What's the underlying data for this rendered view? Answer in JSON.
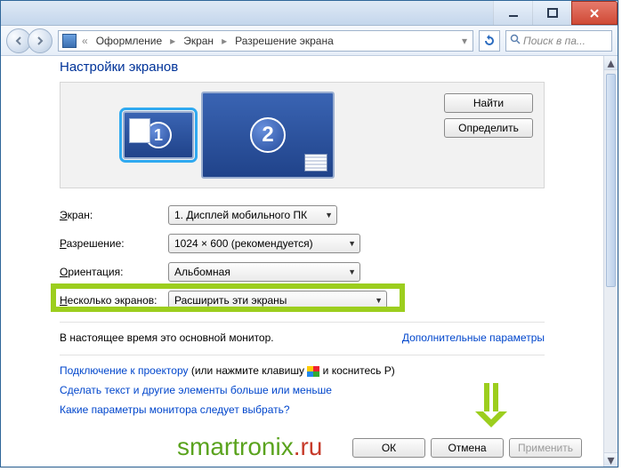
{
  "breadcrumb": {
    "item1": "Оформление",
    "item2": "Экран",
    "item3": "Разрешение экрана"
  },
  "search": {
    "placeholder": "Поиск в па..."
  },
  "page": {
    "title": "Настройки экранов"
  },
  "preview": {
    "monitor1_num": "1",
    "monitor2_num": "2",
    "find_btn": "Найти",
    "detect_btn": "Определить"
  },
  "form": {
    "screen_label_pre": "Э",
    "screen_label_post": "кран:",
    "screen_value": "1. Дисплей мобильного ПК",
    "res_label_pre": "Р",
    "res_label_post": "азрешение:",
    "res_value": "1024 × 600 (рекомендуется)",
    "orient_label_pre": "О",
    "orient_label_post": "риентация:",
    "orient_value": "Альбомная",
    "multi_label_pre": "Н",
    "multi_label_post": "есколько экранов:",
    "multi_value": "Расширить эти экраны"
  },
  "info": {
    "primary": "В настоящее время это основной монитор.",
    "advanced": "Дополнительные параметры"
  },
  "links": {
    "projector_link": "Подключение к проектору",
    "projector_rest": " (или нажмите клавишу ",
    "projector_tail": " и коснитесь P)",
    "textsize": "Сделать текст и другие элементы больше или меньше",
    "whichparams": "Какие параметры монитора следует выбрать?"
  },
  "footer": {
    "ok": "ОК",
    "cancel": "Отмена",
    "apply": "Применить"
  },
  "watermark": {
    "part1": "smartronix",
    "part2": ".ru"
  }
}
